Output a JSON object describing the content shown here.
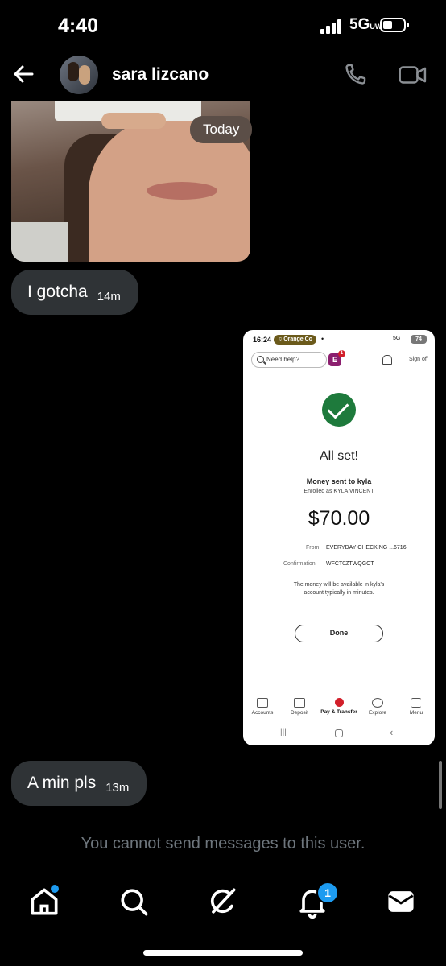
{
  "status_bar": {
    "time": "4:40",
    "network": "5G",
    "network_suffix": "UW"
  },
  "header": {
    "contact_name": "sara lizcano",
    "icons": [
      "back-arrow-icon",
      "phone-icon",
      "video-camera-icon"
    ]
  },
  "conversation": {
    "date_separator": "Today",
    "messages": [
      {
        "type": "image",
        "description_icon": "photo"
      },
      {
        "type": "text",
        "text": "I gotcha",
        "time": "14m"
      },
      {
        "type": "image",
        "content": "screenshot"
      },
      {
        "type": "text",
        "text": "A min pls",
        "time": "13m"
      }
    ]
  },
  "screenshot": {
    "time": "16:24",
    "music_pill": "♫ Orange Co",
    "status_right": "5G",
    "battery": "74",
    "search_placeholder": "Need help?",
    "erica_badge": "1",
    "sign_off": "Sign off",
    "heading": "All set!",
    "money_sent": "Money sent to kyla",
    "enrolled": "Enrolled as KYLA VINCENT",
    "amount": "$70.00",
    "from_label": "From",
    "from_value": "EVERYDAY CHECKING ...6716",
    "confirmation_label": "Confirmation",
    "confirmation_value": "WFCT0ZTWQGCT",
    "note": "The money will be available in kyla's account typically in minutes.",
    "done_button": "Done",
    "nav": [
      "Accounts",
      "Deposit",
      "Pay & Transfer",
      "Explore",
      "Menu"
    ],
    "active_nav": "Pay & Transfer"
  },
  "notice": "You cannot send messages to this user.",
  "bottom_nav": {
    "items": [
      "home-icon",
      "search-icon",
      "grok-icon",
      "notifications-icon",
      "messages-icon"
    ],
    "notification_count": "1"
  },
  "colors": {
    "bubble": "#2f3336",
    "accent": "#1d9bf0",
    "muted": "#6e767d"
  }
}
